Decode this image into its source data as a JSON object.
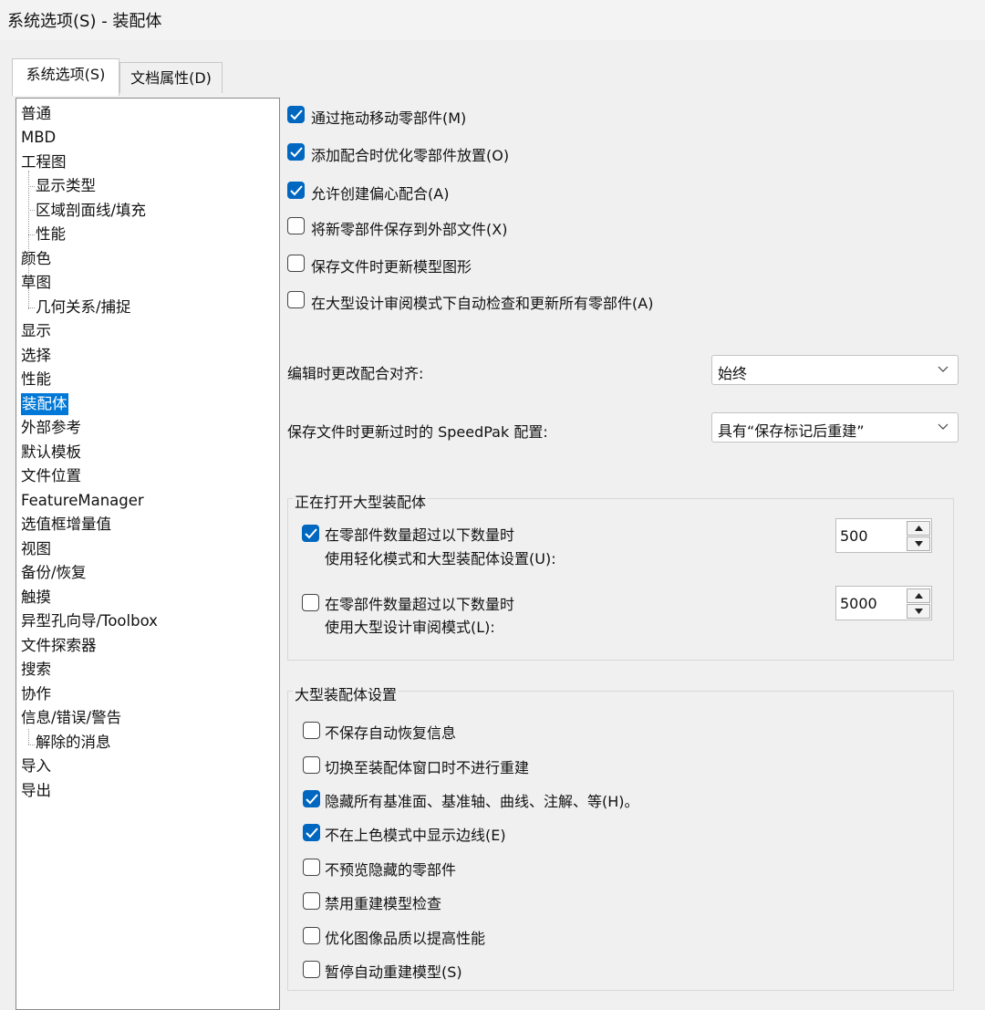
{
  "window": {
    "title": "系统选项(S) - 装配体"
  },
  "tabs": [
    {
      "label": "系统选项(S)",
      "active": true
    },
    {
      "label": "文档属性(D)",
      "active": false
    }
  ],
  "tree": {
    "items": [
      {
        "label": "普通",
        "level": 0
      },
      {
        "label": "MBD",
        "level": 0
      },
      {
        "label": "工程图",
        "level": 0
      },
      {
        "label": "显示类型",
        "level": 1
      },
      {
        "label": "区域剖面线/填充",
        "level": 1
      },
      {
        "label": "性能",
        "level": 1
      },
      {
        "label": "颜色",
        "level": 0
      },
      {
        "label": "草图",
        "level": 0
      },
      {
        "label": "几何关系/捕捉",
        "level": 1
      },
      {
        "label": "显示",
        "level": 0
      },
      {
        "label": "选择",
        "level": 0
      },
      {
        "label": "性能",
        "level": 0
      },
      {
        "label": "装配体",
        "level": 0,
        "selected": true
      },
      {
        "label": "外部参考",
        "level": 0
      },
      {
        "label": "默认模板",
        "level": 0
      },
      {
        "label": "文件位置",
        "level": 0
      },
      {
        "label": "FeatureManager",
        "level": 0
      },
      {
        "label": "选值框增量值",
        "level": 0
      },
      {
        "label": "视图",
        "level": 0
      },
      {
        "label": "备份/恢复",
        "level": 0
      },
      {
        "label": "触摸",
        "level": 0
      },
      {
        "label": "异型孔向导/Toolbox",
        "level": 0
      },
      {
        "label": "文件探索器",
        "level": 0
      },
      {
        "label": "搜索",
        "level": 0
      },
      {
        "label": "协作",
        "level": 0
      },
      {
        "label": "信息/错误/警告",
        "level": 0
      },
      {
        "label": "解除的消息",
        "level": 1
      },
      {
        "label": "导入",
        "level": 0
      },
      {
        "label": "导出",
        "level": 0
      }
    ]
  },
  "options": [
    {
      "label": "通过拖动移动零部件(M)",
      "checked": true
    },
    {
      "label": "添加配合时优化零部件放置(O)",
      "checked": true
    },
    {
      "label": "允许创建偏心配合(A)",
      "checked": true
    },
    {
      "label": "将新零部件保存到外部文件(X)",
      "checked": false
    },
    {
      "label": "保存文件时更新模型图形",
      "checked": false
    },
    {
      "label": "在大型设计审阅模式下自动检查和更新所有零部件(A)",
      "checked": false
    }
  ],
  "mate_align": {
    "label": "编辑时更改配合对齐:",
    "value": "始终"
  },
  "speedpak": {
    "label": "保存文件时更新过时的 SpeedPak 配置:",
    "value": "具有“保存标记后重建”"
  },
  "opening_group": {
    "title": "正在打开大型装配体",
    "rows": [
      {
        "line1": "在零部件数量超过以下数量时",
        "line2": "使用轻化模式和大型装配体设置(U):",
        "checked": true,
        "value": "500"
      },
      {
        "line1": "在零部件数量超过以下数量时",
        "line2": "使用大型设计审阅模式(L):",
        "checked": false,
        "value": "5000"
      }
    ]
  },
  "large_settings": {
    "title": "大型装配体设置",
    "items": [
      {
        "label": "不保存自动恢复信息",
        "checked": false
      },
      {
        "label": "切换至装配体窗口时不进行重建",
        "checked": false
      },
      {
        "label": "隐藏所有基准面、基准轴、曲线、注解、等(H)。",
        "checked": true
      },
      {
        "label": "不在上色模式中显示边线(E)",
        "checked": true
      },
      {
        "label": "不预览隐藏的零部件",
        "checked": false
      },
      {
        "label": "禁用重建模型检查",
        "checked": false
      },
      {
        "label": "优化图像品质以提高性能",
        "checked": false
      },
      {
        "label": "暂停自动重建模型(S)",
        "checked": false
      }
    ]
  },
  "icons": {
    "check": "checkmark-icon",
    "chevron": "chevron-down-icon",
    "spin_up": "arrow-up-icon",
    "spin_down": "arrow-down-icon"
  },
  "colors": {
    "accent": "#0067c0",
    "selected": "#0078d7"
  }
}
